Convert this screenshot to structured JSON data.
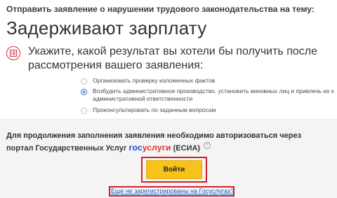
{
  "form": {
    "subject_prompt": "Отправить заявление о нарушении трудового законодательства на тему:",
    "topic_title": "Задерживают зарплату",
    "question_icon": "document-list-icon",
    "question": "Укажите, какой результат вы хотели бы получить после рассмотрения вашего заявления:",
    "options": [
      {
        "label": "Организовать проверку изложенных фактов",
        "selected": false
      },
      {
        "label": "Возбудить административное производство, установить виновных лиц и привлечь их к административной ответственности",
        "selected": true
      },
      {
        "label": "Проконсультировать по заданным вопросам",
        "selected": false
      }
    ]
  },
  "auth": {
    "text_before": "Для продолжения заполнения заявления необходимо авторизоваться через портал Государственных Услуг",
    "logo_part1": "гос",
    "logo_part2": "услуги",
    "text_after": "(ЕСИА)",
    "help_symbol": "?",
    "login_button": "Войти",
    "register_link": "Еще не зарегистрированы на Госуслугах?"
  },
  "colors": {
    "accent_red": "#d11f2b",
    "button_yellow": "#f7c21a",
    "link_blue": "#1c5fb8",
    "radio_blue": "#1c6fd1"
  }
}
